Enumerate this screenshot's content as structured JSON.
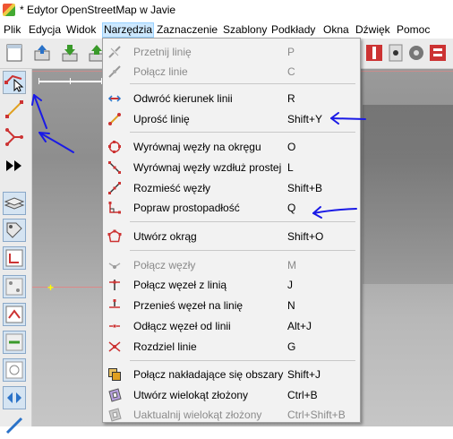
{
  "window": {
    "title": "* Edytor OpenStreetMap w Javie"
  },
  "menubar": [
    "Plik",
    "Edycja",
    "Widok",
    "Narzędzia",
    "Zaznaczenie",
    "Szablony",
    "Podkłady",
    "Okna",
    "Dźwięk",
    "Pomoc"
  ],
  "active_menu": "Narzędzia",
  "tools_menu": {
    "items": [
      {
        "label": "Przetnij linię",
        "shortcut": "P",
        "enabled": false,
        "icon": "split-way-icon"
      },
      {
        "label": "Połącz linie",
        "shortcut": "C",
        "enabled": false,
        "icon": "combine-way-icon"
      },
      {
        "label": "Odwróć kierunek linii",
        "shortcut": "R",
        "enabled": true,
        "icon": "reverse-way-icon"
      },
      {
        "label": "Uprość linię",
        "shortcut": "Shift+Y",
        "enabled": true,
        "icon": "simplify-way-icon"
      },
      {
        "label": "Wyrównaj węzły na okręgu",
        "shortcut": "O",
        "enabled": true,
        "icon": "align-circle-icon"
      },
      {
        "label": "Wyrównaj węzły wzdłuż prostej",
        "shortcut": "L",
        "enabled": true,
        "icon": "align-line-icon"
      },
      {
        "label": "Rozmieść węzły",
        "shortcut": "Shift+B",
        "enabled": true,
        "icon": "distribute-nodes-icon"
      },
      {
        "label": "Popraw prostopadłość",
        "shortcut": "Q",
        "enabled": true,
        "icon": "orthogonalize-icon"
      },
      {
        "label": "Utwórz okrąg",
        "shortcut": "Shift+O",
        "enabled": true,
        "icon": "create-circle-icon"
      },
      {
        "label": "Połącz węzły",
        "shortcut": "M",
        "enabled": false,
        "icon": "merge-nodes-icon"
      },
      {
        "label": "Połącz węzeł z linią",
        "shortcut": "J",
        "enabled": true,
        "icon": "join-node-way-icon"
      },
      {
        "label": "Przenieś węzeł na linię",
        "shortcut": "N",
        "enabled": true,
        "icon": "move-node-onto-way-icon"
      },
      {
        "label": "Odłącz węzeł od linii",
        "shortcut": "Alt+J",
        "enabled": true,
        "icon": "disconnect-node-icon"
      },
      {
        "label": "Rozdziel linie",
        "shortcut": "G",
        "enabled": true,
        "icon": "unglue-ways-icon"
      },
      {
        "label": "Połącz nakładające się obszary",
        "shortcut": "Shift+J",
        "enabled": true,
        "icon": "join-areas-icon"
      },
      {
        "label": "Utwórz wielokąt złożony",
        "shortcut": "Ctrl+B",
        "enabled": true,
        "icon": "create-multipolygon-icon"
      },
      {
        "label": "Uaktualnij wielokąt złożony",
        "shortcut": "Ctrl+Shift+B",
        "enabled": false,
        "icon": "update-multipolygon-icon"
      }
    ]
  },
  "colors": {
    "annotation_arrow": "#1a1ae6",
    "menu_highlight": "#cce8ff",
    "menu_background": "#f2f2f2",
    "disabled_text": "#8a8a8a"
  }
}
